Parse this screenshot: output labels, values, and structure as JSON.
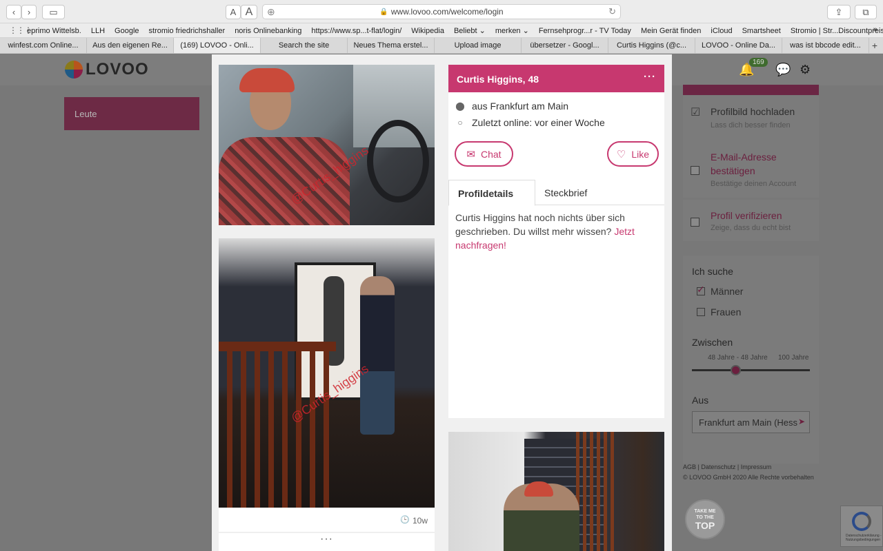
{
  "browser": {
    "url": "www.lovoo.com/welcome/login",
    "font_small": "A",
    "font_large": "A",
    "bookmarks": [
      "eprimo Wittelsb.",
      "LLH",
      "Google",
      "stromio friedrichshaller",
      "noris Onlinebanking",
      "https://www.sp...t-flat/login/",
      "Wikipedia",
      "Beliebt ⌄",
      "merken ⌄",
      "Fernsehprogr...r - TV Today",
      "Mein Gerät finden",
      "iCloud",
      "Smartsheet",
      "Stromio | Str...Discountpreis"
    ],
    "bookmarks_more": "»",
    "tabs": [
      "winfest.com Online...",
      "Aus den eigenen Re...",
      "(169) LOVOO - Onli...",
      "Search the site",
      "Neues Thema erstel...",
      "Upload image",
      "übersetzer - Googl...",
      "Curtis Higgins (@c...",
      "LOVOO - Online Da...",
      "was ist bbcode edit..."
    ],
    "active_tab_index": 2,
    "new_tab": "+"
  },
  "site": {
    "logo_text": "LOVOO",
    "notification_count": "169",
    "nav_leute": "Leute"
  },
  "tasks": [
    {
      "title": "Profilbild hochladen",
      "subtitle": "Lass dich besser finden",
      "done": true
    },
    {
      "title": "E-Mail-Adresse bestätigen",
      "subtitle": "Bestätige deinen Account",
      "done": false
    },
    {
      "title": "Profil verifizieren",
      "subtitle": "Zeige, dass du echt bist",
      "done": false
    }
  ],
  "search": {
    "looking_for_label": "Ich suche",
    "options": [
      {
        "label": "Männer",
        "checked": true
      },
      {
        "label": "Frauen",
        "checked": false
      }
    ],
    "between_label": "Zwischen",
    "range_value": "48 Jahre - 48 Jahre",
    "range_max": "100 Jahre",
    "age_selected": 48,
    "from_label": "Aus",
    "location": "Frankfurt am Main (Hess"
  },
  "footer": {
    "links": "AGB | Datenschutz | Impressum",
    "copyright": "© LOVOO GmbH 2020 Alle Rechte vorbehalten",
    "top_small1": "TAKE ME",
    "top_small2": "TO THE",
    "top_big": "TOP",
    "recaptcha_text": "Datenschutzerklärung - Nutzungsbedingungen"
  },
  "profile": {
    "name_age": "Curtis Higgins, 48",
    "menu": "···",
    "location": "aus Frankfurt am Main",
    "last_online": "Zuletzt online: vor einer Woche",
    "chat_label": "Chat",
    "like_label": "Like",
    "tab_details": "Profildetails",
    "tab_steckbrief": "Steckbrief",
    "about_text": "Curtis Higgins hat noch nichts über sich geschrieben. Du willst mehr wissen?",
    "about_link": "Jetzt nachfragen!",
    "photo_age": "10w",
    "photo_more": "···",
    "watermark": "@Curtis_higgins"
  },
  "colors": {
    "accent": "#c7386f",
    "badge": "#3f6b2e"
  }
}
